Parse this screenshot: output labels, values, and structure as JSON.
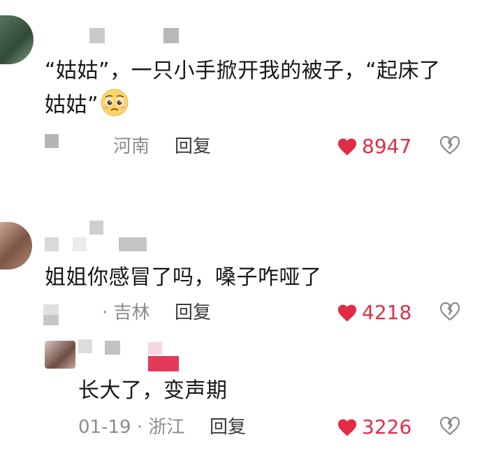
{
  "colors": {
    "like": "#e02c45",
    "text": "#161616",
    "meta": "#8c8c8c"
  },
  "comments": [
    {
      "text": "“姑姑”，一只小手掀开我的被子，“起床了姑姑”",
      "text_line1": "“姑姑”，一只小手掀开我的被子，“起床了",
      "text_line2": "姑姑”",
      "emoji": "pleading-face-emoji",
      "location": "河南",
      "reply_label": "回复",
      "likes": "8947"
    },
    {
      "text": "姐姐你感冒了吗，嗓子咋哑了",
      "location": "· 吉林",
      "reply_label": "回复",
      "likes": "4218"
    },
    {
      "text": "长大了，变声期",
      "meta": "01-19 · 浙江",
      "reply_label": "回复",
      "likes": "3226",
      "is_reply": true
    }
  ]
}
